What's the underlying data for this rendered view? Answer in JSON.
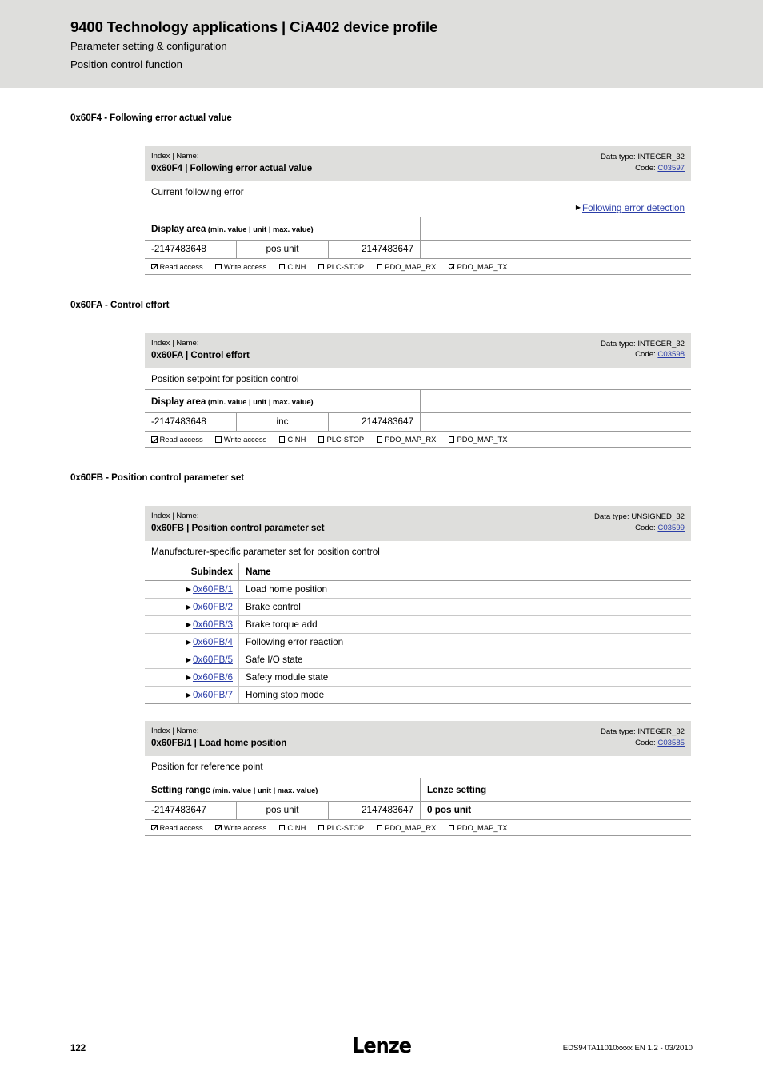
{
  "header": {
    "title": "9400 Technology applications | CiA402 device profile",
    "subtitle1": "Parameter setting & configuration",
    "subtitle2": "Position control function"
  },
  "labels": {
    "index_name": "Index | Name:",
    "data_type_prefix": "Data type: ",
    "code_prefix": "Code: ",
    "display_area": "Display area",
    "setting_range": "Setting range",
    "range_legend": " (min. value | unit | max. value)",
    "lenze_setting": "Lenze setting",
    "subindex": "Subindex",
    "name": "Name",
    "flag_read": "Read access",
    "flag_write": "Write access",
    "flag_cinh": "CINH",
    "flag_plcstop": "PLC-STOP",
    "flag_pdo_rx": "PDO_MAP_RX",
    "flag_pdo_tx": "PDO_MAP_TX"
  },
  "sections": [
    {
      "heading": "0x60F4 - Following error actual value",
      "index_name": "0x60F4 | Following error actual value",
      "data_type": "INTEGER_32",
      "code": "C03597",
      "description": "Current following error",
      "xref": "Following error detection",
      "range_label": "Display area",
      "min": "-2147483648",
      "unit": "pos unit",
      "max": "2147483647",
      "lenze_value": "",
      "flags": {
        "read": true,
        "write": false,
        "cinh": false,
        "plcstop": false,
        "pdo_rx": false,
        "pdo_tx": true
      }
    },
    {
      "heading": "0x60FA - Control effort",
      "index_name": "0x60FA | Control effort",
      "data_type": "INTEGER_32",
      "code": "C03598",
      "description": "Position setpoint for position control",
      "xref": "",
      "range_label": "Display area",
      "min": "-2147483648",
      "unit": "inc",
      "max": "2147483647",
      "lenze_value": "",
      "flags": {
        "read": true,
        "write": false,
        "cinh": false,
        "plcstop": false,
        "pdo_rx": false,
        "pdo_tx": false
      }
    }
  ],
  "subindex_section": {
    "heading": "0x60FB - Position control parameter set",
    "index_name": "0x60FB | Position control parameter set",
    "data_type": "UNSIGNED_32",
    "code": "C03599",
    "description": "Manufacturer-specific parameter set for position control",
    "rows": [
      {
        "subindex": "0x60FB/1",
        "name": "Load home position"
      },
      {
        "subindex": "0x60FB/2",
        "name": "Brake control"
      },
      {
        "subindex": "0x60FB/3",
        "name": "Brake torque add"
      },
      {
        "subindex": "0x60FB/4",
        "name": "Following error reaction"
      },
      {
        "subindex": "0x60FB/5",
        "name": "Safe I/O state"
      },
      {
        "subindex": "0x60FB/6",
        "name": "Safety module state"
      },
      {
        "subindex": "0x60FB/7",
        "name": "Homing stop mode"
      }
    ]
  },
  "detail_section": {
    "index_name": "0x60FB/1 | Load home position",
    "data_type": "INTEGER_32",
    "code": "C03585",
    "description": "Position for reference point",
    "range_label": "Setting range",
    "min": "-2147483647",
    "unit": "pos unit",
    "max": "2147483647",
    "lenze_value": "0 pos unit",
    "flags": {
      "read": true,
      "write": true,
      "cinh": false,
      "plcstop": false,
      "pdo_rx": false,
      "pdo_tx": false
    }
  },
  "footer": {
    "page_number": "122",
    "logo": "Lenze",
    "reference": "EDS94TA11010xxxx EN 1.2 - 03/2010"
  }
}
